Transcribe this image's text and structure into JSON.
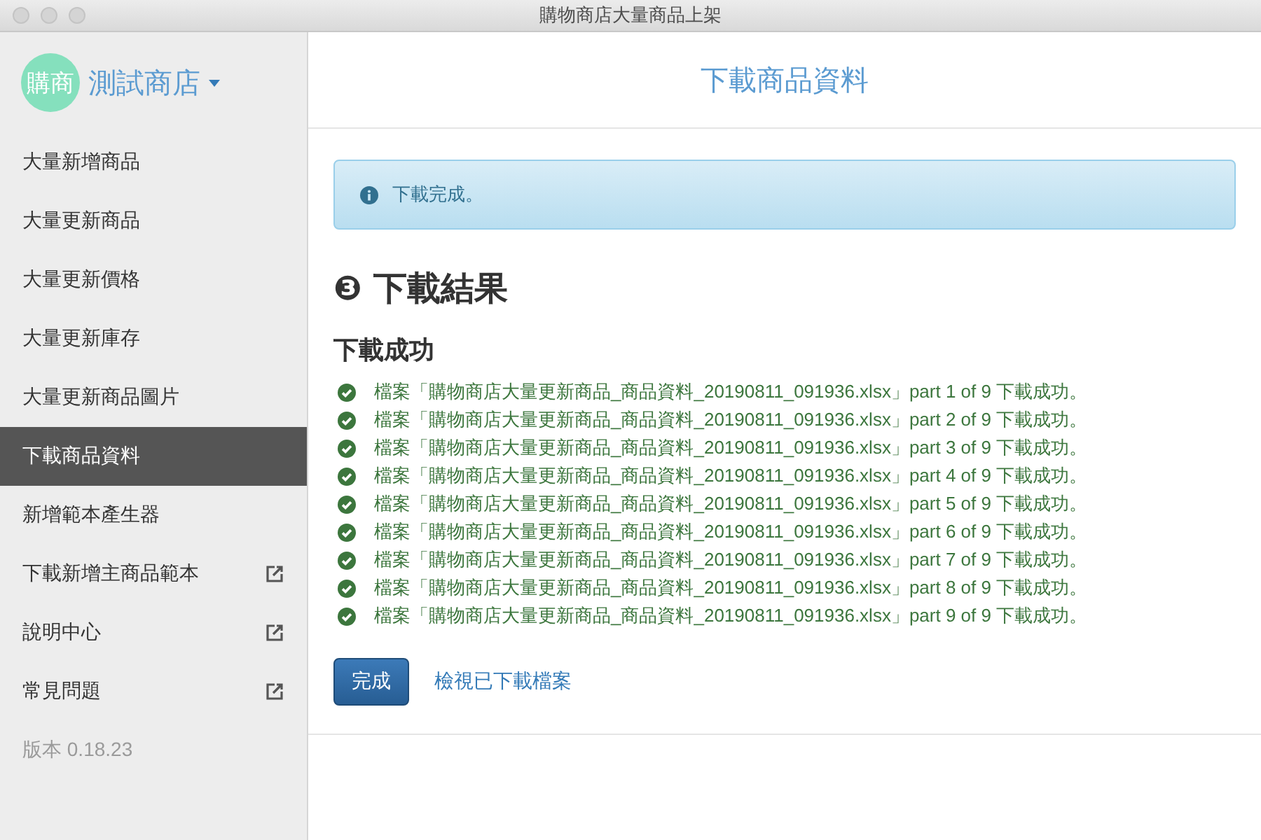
{
  "window": {
    "title": "購物商店大量商品上架"
  },
  "sidebar": {
    "avatar": "購商",
    "store_name": "測試商店",
    "items": [
      {
        "label": "大量新增商品",
        "selected": false,
        "external": false
      },
      {
        "label": "大量更新商品",
        "selected": false,
        "external": false
      },
      {
        "label": "大量更新價格",
        "selected": false,
        "external": false
      },
      {
        "label": "大量更新庫存",
        "selected": false,
        "external": false
      },
      {
        "label": "大量更新商品圖片",
        "selected": false,
        "external": false
      },
      {
        "label": "下載商品資料",
        "selected": true,
        "external": false
      },
      {
        "label": "新增範本產生器",
        "selected": false,
        "external": false
      },
      {
        "label": "下載新增主商品範本",
        "selected": false,
        "external": true
      },
      {
        "label": "說明中心",
        "selected": false,
        "external": true
      },
      {
        "label": "常見問題",
        "selected": false,
        "external": true
      }
    ],
    "version": "版本 0.18.23"
  },
  "page": {
    "title": "下載商品資料",
    "alert": "下載完成。",
    "step_number": "❸",
    "heading": "下載結果",
    "subheading": "下載成功",
    "results": [
      "檔案「購物商店大量更新商品_商品資料_20190811_091936.xlsx」part 1 of 9 下載成功。",
      "檔案「購物商店大量更新商品_商品資料_20190811_091936.xlsx」part 2 of 9 下載成功。",
      "檔案「購物商店大量更新商品_商品資料_20190811_091936.xlsx」part 3 of 9 下載成功。",
      "檔案「購物商店大量更新商品_商品資料_20190811_091936.xlsx」part 4 of 9 下載成功。",
      "檔案「購物商店大量更新商品_商品資料_20190811_091936.xlsx」part 5 of 9 下載成功。",
      "檔案「購物商店大量更新商品_商品資料_20190811_091936.xlsx」part 6 of 9 下載成功。",
      "檔案「購物商店大量更新商品_商品資料_20190811_091936.xlsx」part 7 of 9 下載成功。",
      "檔案「購物商店大量更新商品_商品資料_20190811_091936.xlsx」part 8 of 9 下載成功。",
      "檔案「購物商店大量更新商品_商品資料_20190811_091936.xlsx」part 9 of 9 下載成功。"
    ],
    "done_button": "完成",
    "view_link": "檢視已下載檔案"
  }
}
